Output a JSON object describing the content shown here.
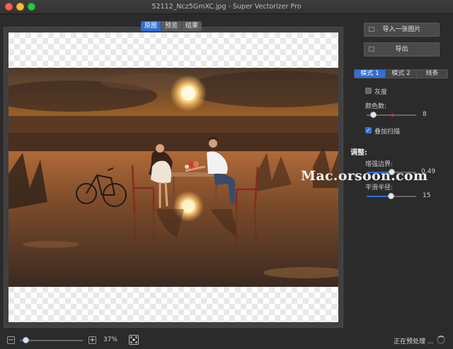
{
  "window": {
    "title": "52112_Ncz5GmXC.jpg - Super Vectorizer Pro"
  },
  "view_tabs": [
    "原图",
    "预览",
    "结果"
  ],
  "view_tab_active": 0,
  "actions": {
    "import_label": "导入一张图片",
    "export_label": "导出"
  },
  "mode_tabs": [
    "模式 1",
    "模式 2",
    "线条"
  ],
  "mode_tab_active": 0,
  "settings": {
    "grayscale_label": "灰度",
    "grayscale_checked": false,
    "colors_label": "颜色数:",
    "colors_value": "8",
    "stacked_scan_label": "叠加扫描",
    "stacked_scan_checked": true
  },
  "adjust": {
    "heading": "调整:",
    "edge_label": "增强边界:",
    "edge_value": "0.49",
    "smooth_label": "平滑半径:",
    "smooth_value": "15"
  },
  "watermark": "Mac.orsoon.com",
  "zoom": {
    "minus_label": "−",
    "plus_label": "+",
    "percent": "37%"
  },
  "status": {
    "text": "正在预处理 ..."
  },
  "colors": {
    "accent": "#2f6fd6",
    "window_bg": "#2b2b2b",
    "panel_bg": "#404040"
  }
}
